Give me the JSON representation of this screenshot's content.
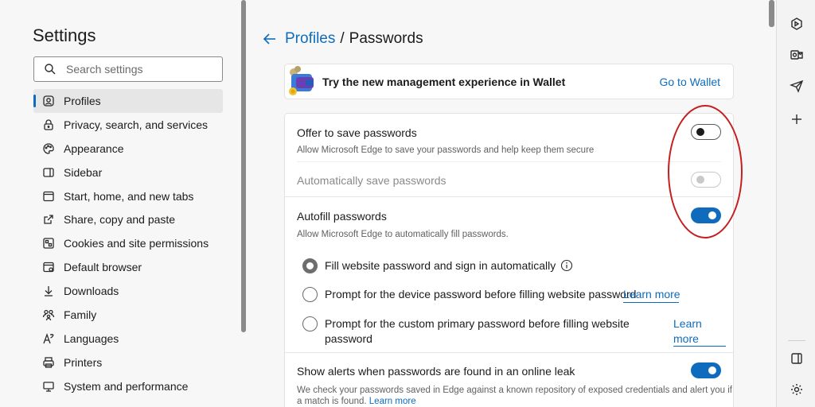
{
  "settings": {
    "title": "Settings",
    "search_placeholder": "Search settings",
    "nav": [
      {
        "label": "Profiles",
        "icon": "profile-icon",
        "active": true
      },
      {
        "label": "Privacy, search, and services",
        "icon": "lock-icon"
      },
      {
        "label": "Appearance",
        "icon": "palette-icon"
      },
      {
        "label": "Sidebar",
        "icon": "sidebar-icon"
      },
      {
        "label": "Start, home, and new tabs",
        "icon": "home-icon"
      },
      {
        "label": "Share, copy and paste",
        "icon": "share-icon"
      },
      {
        "label": "Cookies and site permissions",
        "icon": "cookie-icon"
      },
      {
        "label": "Default browser",
        "icon": "browser-icon"
      },
      {
        "label": "Downloads",
        "icon": "download-icon"
      },
      {
        "label": "Family",
        "icon": "family-icon"
      },
      {
        "label": "Languages",
        "icon": "languages-icon"
      },
      {
        "label": "Printers",
        "icon": "printer-icon"
      },
      {
        "label": "System and performance",
        "icon": "system-icon"
      }
    ]
  },
  "breadcrumb": {
    "parent": "Profiles",
    "separator": "/",
    "current": "Passwords"
  },
  "wallet_banner": {
    "text": "Try the new management experience in Wallet",
    "link": "Go to Wallet"
  },
  "passwords": {
    "offer_save": {
      "title": "Offer to save passwords",
      "desc": "Allow Microsoft Edge to save your passwords and help keep them secure",
      "enabled": false
    },
    "auto_save": {
      "title": "Automatically save passwords",
      "enabled": false,
      "disabled": true
    },
    "autofill": {
      "title": "Autofill passwords",
      "desc": "Allow Microsoft Edge to automatically fill passwords.",
      "enabled": true,
      "options": [
        {
          "label": "Fill website password and sign in automatically",
          "checked": true
        },
        {
          "label": "Prompt for the device password before filling website password",
          "link": "Learn more",
          "checked": false
        },
        {
          "label_line1": "Prompt for the custom primary password before filling website",
          "label_line2": "password",
          "link_line1": "Learn",
          "link_line2": "more",
          "checked": false
        }
      ]
    },
    "leak_alerts": {
      "title": "Show alerts when passwords are found in an online leak",
      "desc_line1": "We check your passwords saved in Edge against a known repository of exposed credentials and alert you if",
      "desc_line2": "a match is found.",
      "link": "Learn more",
      "enabled": true
    }
  },
  "colors": {
    "accent": "#0f6cbd",
    "annotation": "#c41f1f"
  }
}
